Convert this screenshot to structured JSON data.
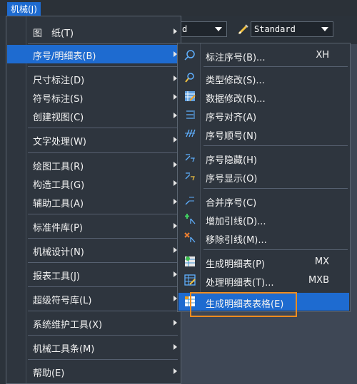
{
  "menubar": {
    "title": "机械(J)"
  },
  "toolbar": {
    "combo1": "d",
    "combo2": "Standard"
  },
  "menu1": {
    "items": [
      {
        "label": "图　纸(T)"
      },
      {
        "label": "序号/明细表(B)"
      },
      {
        "label": "尺寸标注(D)"
      },
      {
        "label": "符号标注(S)"
      },
      {
        "label": "创建视图(C)"
      },
      {
        "label": "文字处理(W)"
      },
      {
        "label": "绘图工具(R)"
      },
      {
        "label": "构造工具(G)"
      },
      {
        "label": "辅助工具(A)"
      },
      {
        "label": "标准件库(P)"
      },
      {
        "label": "机械设计(N)"
      },
      {
        "label": "报表工具(J)"
      },
      {
        "label": "超级符号库(L)"
      },
      {
        "label": "系统维护工具(X)"
      },
      {
        "label": "机械工具条(M)"
      },
      {
        "label": "帮助(E)"
      }
    ]
  },
  "menu2": {
    "items": [
      {
        "label": "标注序号(B)...",
        "shortcut": "XH",
        "icon": "balloon-number-icon"
      },
      {
        "label": "类型修改(S)...",
        "shortcut": "",
        "icon": "type-edit-icon"
      },
      {
        "label": "数据修改(R)...",
        "shortcut": "",
        "icon": "data-edit-icon"
      },
      {
        "label": "序号对齐(A)",
        "shortcut": "",
        "icon": "align-icon"
      },
      {
        "label": "序号顺号(N)",
        "shortcut": "",
        "icon": "sequence-icon"
      },
      {
        "label": "序号隐藏(H)",
        "shortcut": "",
        "icon": "hide-number-icon"
      },
      {
        "label": "序号显示(O)",
        "shortcut": "",
        "icon": "show-number-icon"
      },
      {
        "label": "合并序号(C)",
        "shortcut": "",
        "icon": "merge-number-icon"
      },
      {
        "label": "增加引线(D)...",
        "shortcut": "",
        "icon": "add-leader-icon"
      },
      {
        "label": "移除引线(M)...",
        "shortcut": "",
        "icon": "remove-leader-icon"
      },
      {
        "label": "生成明细表(P)",
        "shortcut": "MX",
        "icon": "generate-bom-icon"
      },
      {
        "label": "处理明细表(T)...",
        "shortcut": "MXB",
        "icon": "process-bom-icon"
      },
      {
        "label": "生成明细表表格(E)",
        "shortcut": "",
        "icon": "bom-table-icon"
      }
    ]
  }
}
